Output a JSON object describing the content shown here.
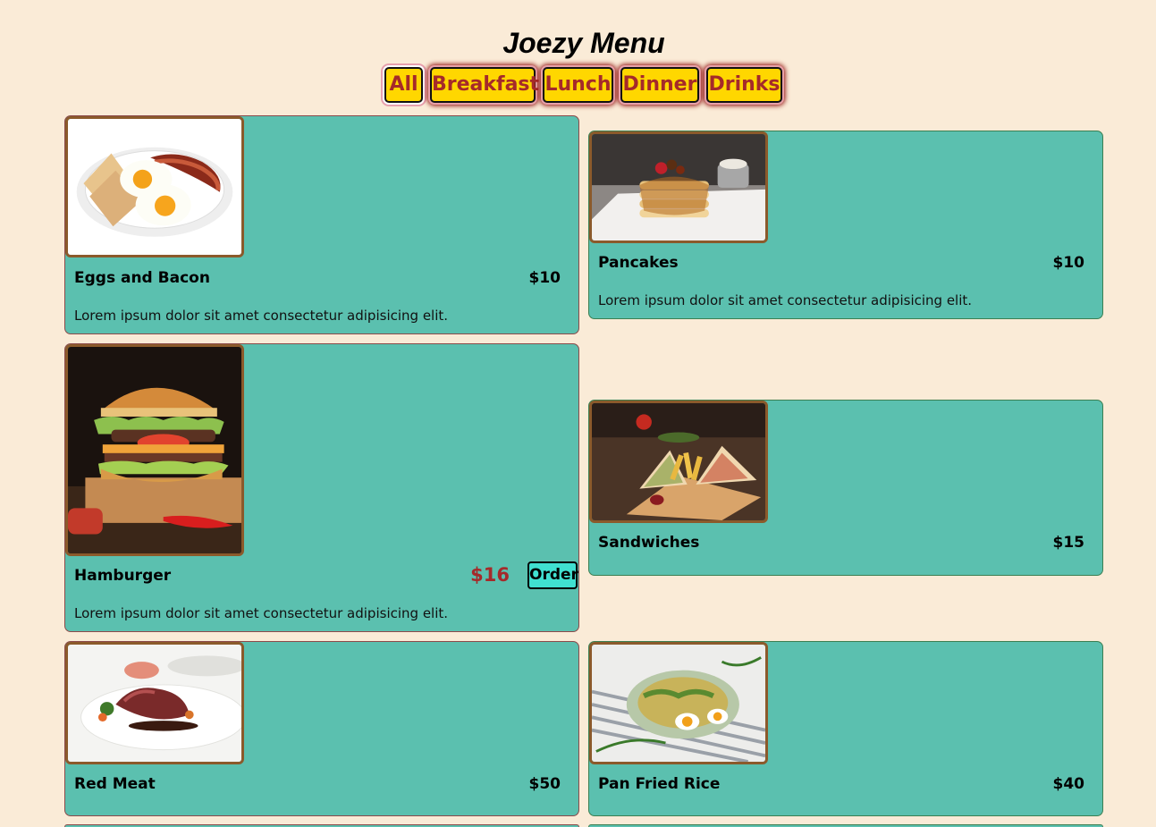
{
  "title": "Joezy Menu",
  "filters": [
    {
      "label": "All",
      "active": true
    },
    {
      "label": "Breakfast"
    },
    {
      "label": "Lunch"
    },
    {
      "label": "Dinner"
    },
    {
      "label": "Drinks"
    }
  ],
  "items": [
    {
      "name": "Eggs and Bacon",
      "price": "$10",
      "description": "Lorem ipsum dolor sit amet consectetur adipisicing elit.",
      "image": "eggs-bacon-photo"
    },
    {
      "name": "Pancakes",
      "price": "$10",
      "description": "Lorem ipsum dolor sit amet consectetur adipisicing elit.",
      "image": "pancakes-photo"
    },
    {
      "name": "Hamburger",
      "price": "$16",
      "description": "Lorem ipsum dolor sit amet consectetur adipisicing elit.",
      "image": "hamburger-photo",
      "order_label": "Order"
    },
    {
      "name": "Sandwiches",
      "price": "$15",
      "image": "sandwiches-photo"
    },
    {
      "name": "Red Meat",
      "price": "$50",
      "image": "red-meat-photo"
    },
    {
      "name": "Pan Fried Rice",
      "price": "$40",
      "image": "pan-fried-rice-photo"
    }
  ],
  "colors": {
    "background": "#faebd7",
    "card": "#5bc0af",
    "filter": "#ffd700",
    "filter_text": "#a52a2a",
    "order": "#40e0d0"
  }
}
